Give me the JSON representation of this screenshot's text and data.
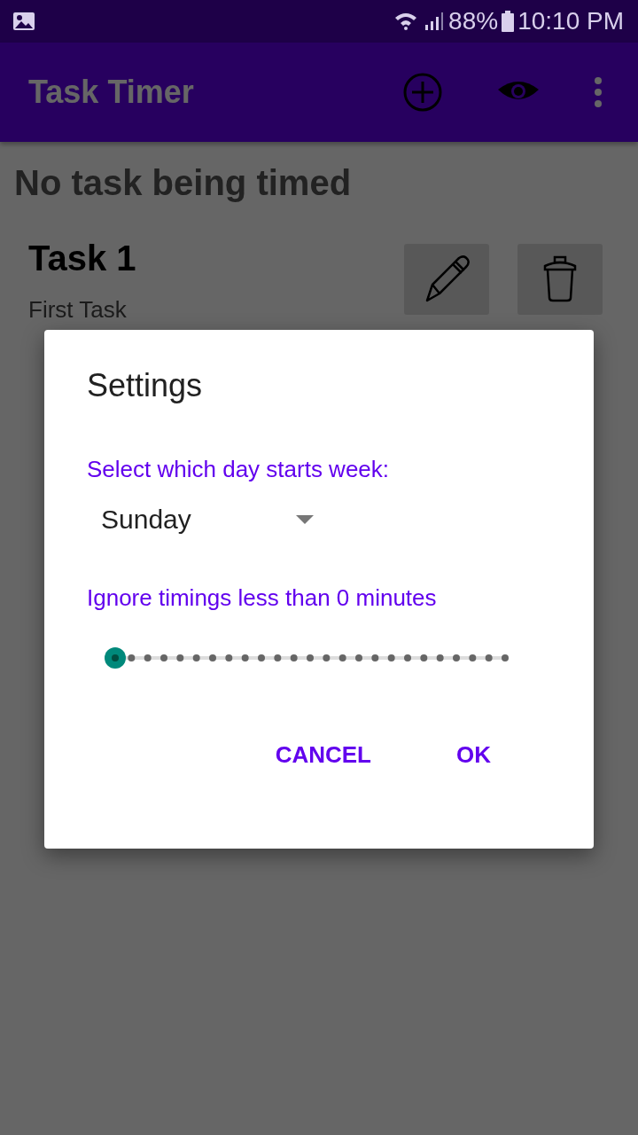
{
  "status_bar": {
    "battery": "88%",
    "time": "10:10 PM"
  },
  "app_bar": {
    "title": "Task Timer"
  },
  "current_task": "No task being timed",
  "tasks": [
    {
      "name": "Task 1",
      "description": "First Task"
    }
  ],
  "dialog": {
    "title": "Settings",
    "week_label": "Select which day starts week:",
    "week_start": "Sunday",
    "ignore_label": "Ignore timings less than 0 minutes",
    "ignore_slider": {
      "level": 0
    },
    "buttons": [
      "CANCEL",
      "OK"
    ]
  }
}
